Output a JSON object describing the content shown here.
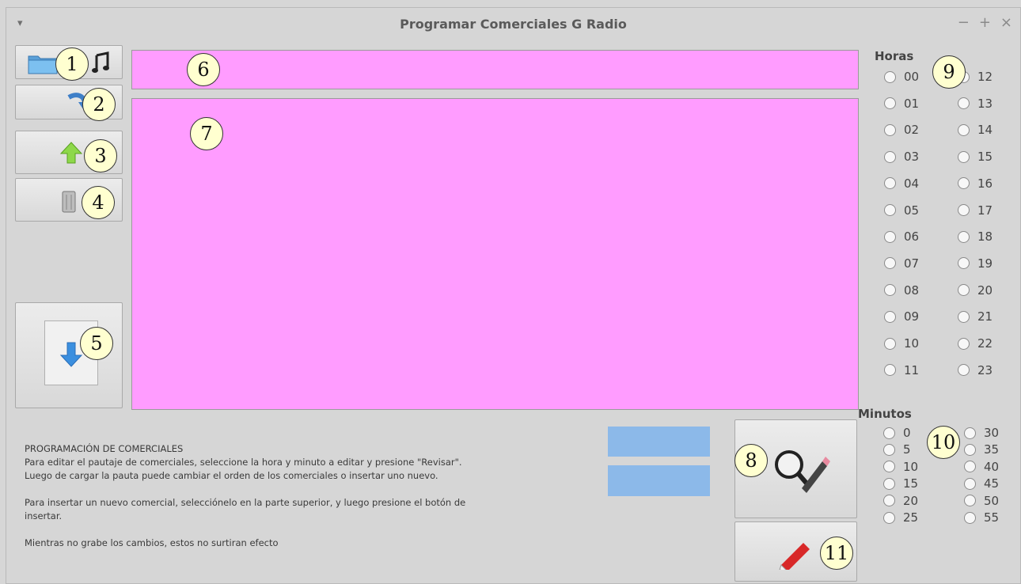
{
  "window": {
    "title": "Programar Comerciales G Radio",
    "controls": {
      "minimize": "−",
      "maximize": "+",
      "close": "×"
    },
    "menu": "▾"
  },
  "callouts": [
    "1",
    "2",
    "3",
    "4",
    "5",
    "6",
    "7",
    "8",
    "9",
    "10",
    "11"
  ],
  "hours": {
    "label": "Horas",
    "left": [
      "00",
      "01",
      "02",
      "03",
      "04",
      "05",
      "06",
      "07",
      "08",
      "09",
      "10",
      "11"
    ],
    "right": [
      "12",
      "13",
      "14",
      "15",
      "16",
      "17",
      "18",
      "19",
      "20",
      "21",
      "22",
      "23"
    ]
  },
  "minutes": {
    "label": "Minutos",
    "left": [
      "0",
      "5",
      "10",
      "15",
      "20",
      "25"
    ],
    "right": [
      "30",
      "35",
      "40",
      "45",
      "50",
      "55"
    ]
  },
  "info": {
    "heading": "PROGRAMACIÓN DE COMERCIALES",
    "p1": "Para editar el pautaje de comerciales, seleccione la hora y minuto a editar y presione \"Revisar\". Luego de cargar la pauta puede cambiar el orden de los comerciales o insertar uno nuevo.",
    "p2": "Para insertar un nuevo comercial, selecciónelo en la parte superior, y luego presione el botón de insertar.",
    "p3": "Mientras no grabe los cambios, estos no surtiran efecto"
  },
  "colors": {
    "panel": "#ff9cff",
    "blue_box": "#8cb9e9",
    "callout": "#ffffd0"
  }
}
